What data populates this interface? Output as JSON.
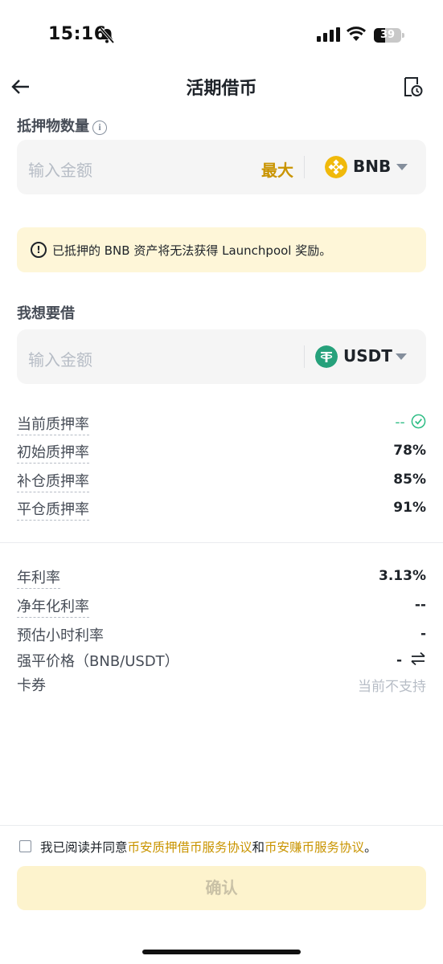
{
  "status_bar": {
    "time": "15:16",
    "battery": "39"
  },
  "header": {
    "title": "活期借币"
  },
  "collateral": {
    "label": "抵押物数量",
    "placeholder": "输入金额",
    "max_label": "最大",
    "asset": "BNB",
    "asset_color": "#f0b90b"
  },
  "notice": {
    "text": "已抵押的 BNB 资产将无法获得 Launchpool 奖励。"
  },
  "borrow": {
    "label": "我想要借",
    "placeholder": "输入金额",
    "asset": "USDT",
    "asset_color": "#26a17b"
  },
  "ltv": {
    "current_label": "当前质押率",
    "current_value": "--",
    "initial_label": "初始质押率",
    "initial_value": "78%",
    "margin_call_label": "补仓质押率",
    "margin_call_value": "85%",
    "liquidation_label": "平仓质押率",
    "liquidation_value": "91%"
  },
  "rates": {
    "annual_label": "年利率",
    "annual_value": "3.13%",
    "net_annual_label": "净年化利率",
    "net_annual_value": "--",
    "hourly_label": "预估小时利率",
    "hourly_value": "-",
    "liq_price_label": "强平价格（BNB/USDT）",
    "liq_price_value": "-",
    "coupon_label": "卡券",
    "coupon_value": "当前不支持"
  },
  "agreement": {
    "prefix": "我已阅读并同意",
    "link1": "币安质押借币服务协议",
    "and": "和",
    "link2": "币安赚币服务协议",
    "suffix": "。"
  },
  "confirm_label": "确认"
}
